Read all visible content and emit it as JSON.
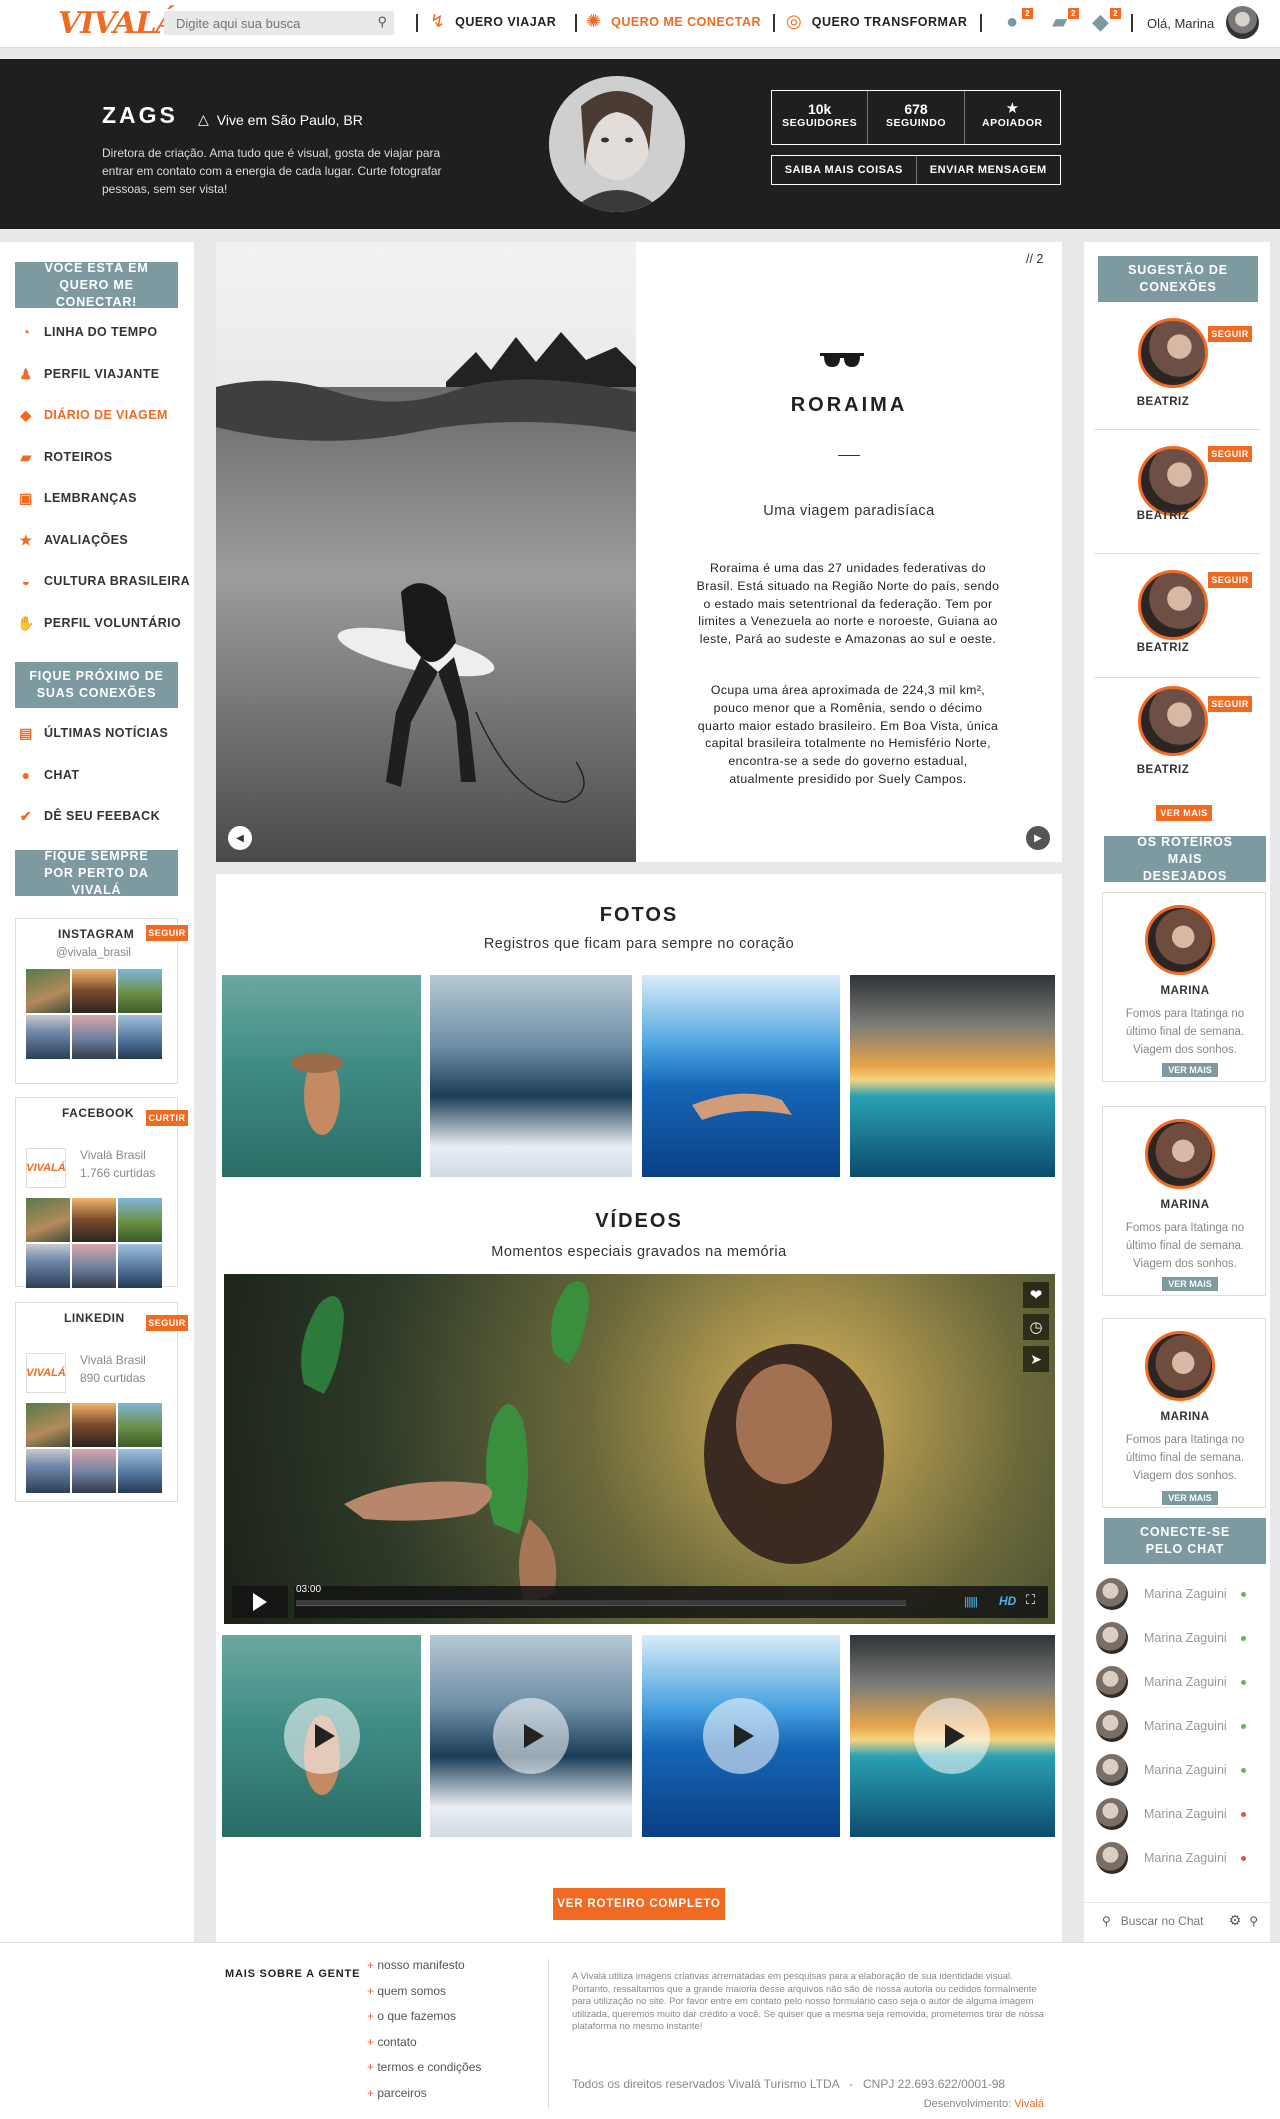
{
  "header": {
    "logo": "VIVALÁ",
    "search_placeholder": "Digite aqui sua busca",
    "nav": [
      {
        "label": "QUERO VIAJAR",
        "active": false
      },
      {
        "label": "QUERO ME CONECTAR",
        "active": true
      },
      {
        "label": "QUERO TRANSFORMAR",
        "active": false
      }
    ],
    "badges": [
      "2",
      "2",
      "2"
    ],
    "greeting": "Olá, Marina"
  },
  "profile": {
    "name": "ZAGS",
    "location": "Vive em São Paulo, BR",
    "bio": "Diretora de criação. Ama tudo que é visual, gosta de viajar para entrar em contato com a energia de cada lugar. Curte fotografar pessoas, sem ser vista!",
    "followers_count": "10k",
    "followers_label": "SEGUIDORES",
    "following_count": "678",
    "following_label": "SEGUINDO",
    "supporter_label": "APOIADOR",
    "more_button": "SAIBA MAIS COISAS",
    "message_button": "ENVIAR MENSAGEM"
  },
  "left": {
    "box1_title": "VOCÊ ESTÁ EM QUERO ME CONECTAR!",
    "menu1": [
      {
        "label": "LINHA DO TEMPO",
        "icon": "clock-icon",
        "glyph": "◔"
      },
      {
        "label": "PERFIL VIAJANTE",
        "icon": "person-icon",
        "glyph": "●"
      },
      {
        "label": "DIÁRIO DE VIAGEM",
        "icon": "notebook-icon",
        "glyph": "◆"
      },
      {
        "label": "ROTEIROS",
        "icon": "map-icon",
        "glyph": "▰"
      },
      {
        "label": "LEMBRANÇAS",
        "icon": "picture-icon",
        "glyph": "▣"
      },
      {
        "label": "AVALIAÇÕES",
        "icon": "star-icon",
        "glyph": "★"
      },
      {
        "label": "CULTURA BRASILEIRA",
        "icon": "mask-icon",
        "glyph": "◒"
      },
      {
        "label": "PERFIL VOLUNTÁRIO",
        "icon": "hand-icon",
        "glyph": "✋"
      }
    ],
    "box2_title": "FIQUE PRÓXIMO DE SUAS CONEXÕES",
    "menu2": [
      {
        "label": "ÚLTIMAS NOTÍCIAS",
        "icon": "newspaper-icon",
        "glyph": "▤"
      },
      {
        "label": "CHAT",
        "icon": "chat-bubble-icon",
        "glyph": "●"
      },
      {
        "label": "DÊ SEU FEEBACK",
        "icon": "check-circle-icon",
        "glyph": "✔"
      }
    ],
    "box3_title": "FIQUE SEMPRE POR PERTO DA VIVALÁ",
    "instagram": {
      "title": "INSTAGRAM",
      "button": "SEGUIR",
      "handle": "@vivala_brasil"
    },
    "facebook": {
      "title": "FACEBOOK",
      "button": "CURTIR",
      "name": "Vivalá Brasil",
      "count": "1.766 curtidas"
    },
    "linkedin": {
      "title": "LINKEDIN",
      "button": "SEGUIR",
      "name": "Vivalá Brasil",
      "count": "890 curtidas"
    }
  },
  "diary": {
    "counter": "// 2",
    "title": "RORAIMA",
    "subtitle": "Uma viagem paradisíaca",
    "paragraph1": "Roraima é uma das 27 unidades federativas do Brasil. Está situado na Região Norte do país, sendo o estado mais setentrional da federação. Tem por limites a Venezuela ao norte e noroeste, Guiana ao leste, Pará ao sudeste e Amazonas ao sul e oeste.",
    "paragraph2": "Ocupa uma área aproximada de 224,3 mil km², pouco menor que a Romênia, sendo o décimo quarto maior estado brasileiro. Em Boa Vista, única capital brasileira totalmente no Hemisfério Norte, encontra-se a sede do governo estadual, atualmente presidido por Suely Campos."
  },
  "photos": {
    "title": "FOTOS",
    "subtitle": "Registros que ficam para sempre no coração"
  },
  "videos": {
    "title": "VÍDEOS",
    "subtitle": "Momentos especiais gravados na memória",
    "time": "03:00",
    "quality": "HD"
  },
  "full_route_button": "VER ROTEIRO COMPLETO",
  "right": {
    "suggestions_title": "SUGESTÃO DE CONEXÕES",
    "suggestions": [
      {
        "name": "BEATRIZ",
        "button": "SEGUIR"
      },
      {
        "name": "BEATRIZ",
        "button": "SEGUIR"
      },
      {
        "name": "BEATRIZ",
        "button": "SEGUIR"
      },
      {
        "name": "BEATRIZ",
        "button": "SEGUIR"
      }
    ],
    "see_more": "VER MAIS",
    "routes_title": "OS ROTEIROS MAIS DESEJADOS",
    "routes": [
      {
        "name": "MARINA",
        "text": "Fomos para Itatinga no último final de semana. Viagem dos sonhos.",
        "button": "VER MAIS"
      },
      {
        "name": "MARINA",
        "text": "Fomos para Itatinga no último final de semana. Viagem dos sonhos.",
        "button": "VER MAIS"
      },
      {
        "name": "MARINA",
        "text": "Fomos para Itatinga no último final de semana. Viagem dos sonhos.",
        "button": "VER MAIS"
      }
    ],
    "chat_title": "CONECTE-SE PELO CHAT",
    "chat_users": [
      {
        "name": "Marina Zaguini",
        "status": "online",
        "color": "#5cb85c"
      },
      {
        "name": "Marina Zaguini",
        "status": "online",
        "color": "#5cb85c"
      },
      {
        "name": "Marina Zaguini",
        "status": "online",
        "color": "#5cb85c"
      },
      {
        "name": "Marina Zaguini",
        "status": "online",
        "color": "#5cb85c"
      },
      {
        "name": "Marina Zaguini",
        "status": "online",
        "color": "#5cb85c"
      },
      {
        "name": "Marina Zaguini",
        "status": "offline",
        "color": "#d9534f"
      },
      {
        "name": "Marina Zaguini",
        "status": "offline",
        "color": "#d9534f"
      }
    ],
    "chat_search_placeholder": "Buscar no Chat"
  },
  "footer": {
    "heading": "MAIS SOBRE A GENTE",
    "links": [
      "nosso manifesto",
      "quem somos",
      "o que fazemos",
      "contato",
      "termos e condições",
      "parceiros"
    ],
    "disclaimer": "A Vivalá utiliza imagens criativas arrematadas em pesquisas para a elaboração de sua identidade visual. Portanto, ressaltamos que a grande maioria desse arquivos não são de nossa autoria ou cedidos formalmente para utilização no site. Por favor entre em contato pelo nosso formulário caso seja o autor de alguma imagem utilizada, queremos muito dar crédito a você. Se quiser que a mesma seja removida, prometemos tirar de nossa plataforma no mesmo instante!",
    "rights": "Todos os direitos reservados Vivalá Turismo LTDA   -   CNPJ 22.693.622/0001-98",
    "dev_label": "Desenvolvimento:",
    "dev_name": "Vivalá"
  }
}
